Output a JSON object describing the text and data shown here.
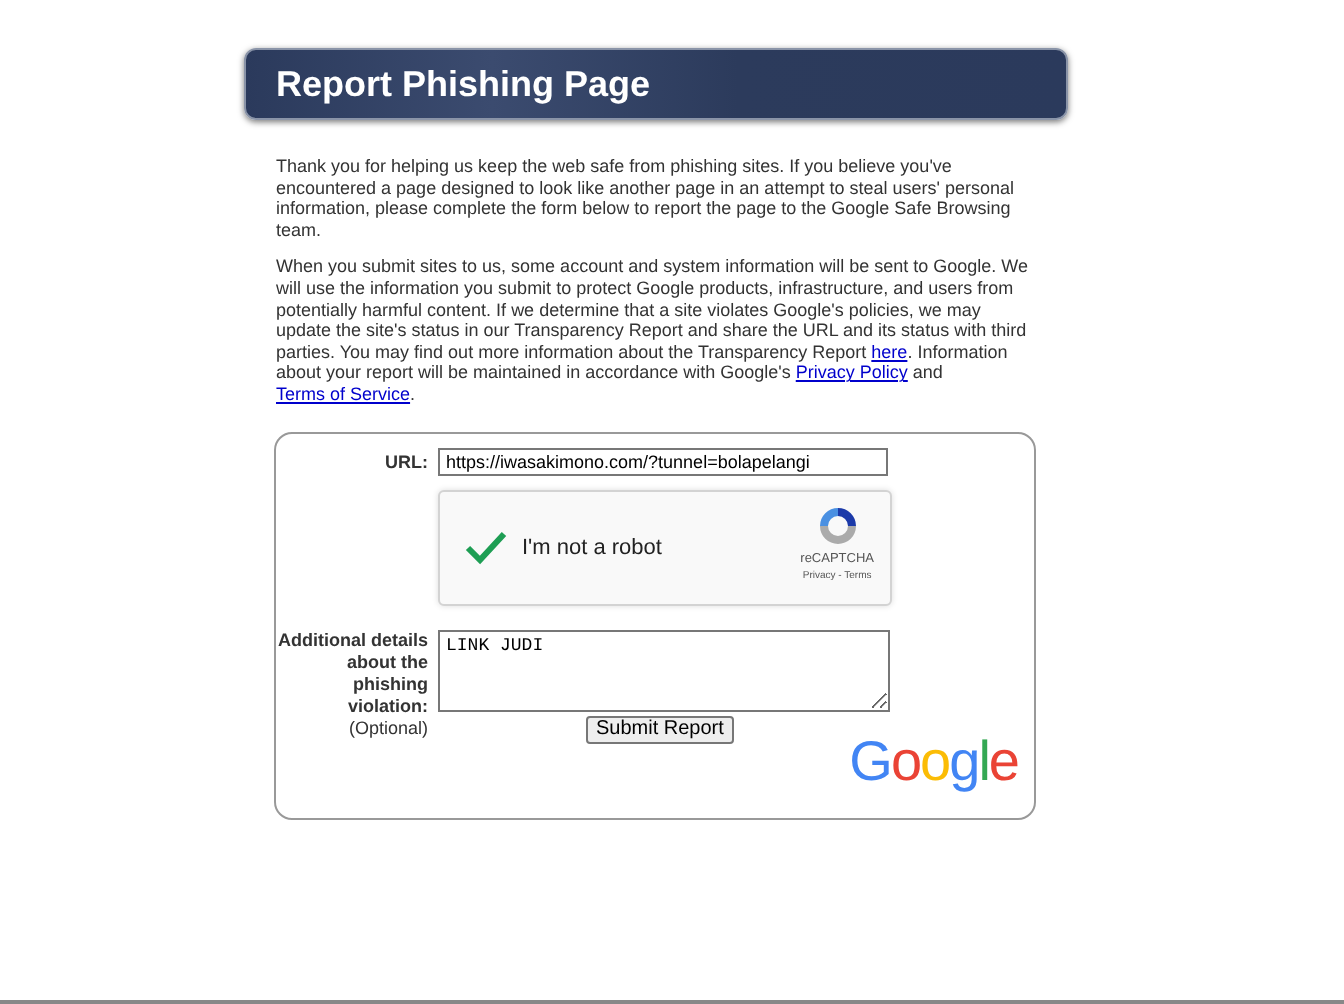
{
  "header": {
    "title": "Report Phishing Page"
  },
  "paragraphs": [
    [
      {
        "kind": "text",
        "text": "Thank you for helping us keep the web safe from phishing sites. If you believe you've encountered a page designed to look like another page in an attempt to steal users' personal information, please complete the form below to report the page to the Google Safe Browsing team."
      }
    ],
    [
      {
        "kind": "text",
        "text": "When you submit sites to us, some account and system information will be sent to Google. We will use the information you submit to protect Google products, infrastructure, and users from potentially harmful content. If we determine that a site violates Google's policies, we may update the site's status in our Transparency Report and share the URL and its status with third parties. You may find out more information about the Transparency Report "
      },
      {
        "kind": "link",
        "text": "here"
      },
      {
        "kind": "text",
        "text": ". Information about your report will be maintained in accordance with Google's "
      },
      {
        "kind": "link",
        "text": "Privacy Policy"
      },
      {
        "kind": "text",
        "text": " and "
      },
      {
        "kind": "link",
        "text": "Terms of Service"
      },
      {
        "kind": "text",
        "text": "."
      }
    ]
  ],
  "form": {
    "url_label": "URL:",
    "url_value": "https://iwasakimono.com/?tunnel=bolapelangi",
    "captcha": {
      "checked": true,
      "label": "I'm not a robot",
      "brand": "reCAPTCHA",
      "links": "Privacy - Terms"
    },
    "details_label": "Additional details about the phishing violation:",
    "details_note": "(Optional)",
    "details_value": "LINK JUDI",
    "submit": "Submit Report",
    "logo": "Google"
  }
}
